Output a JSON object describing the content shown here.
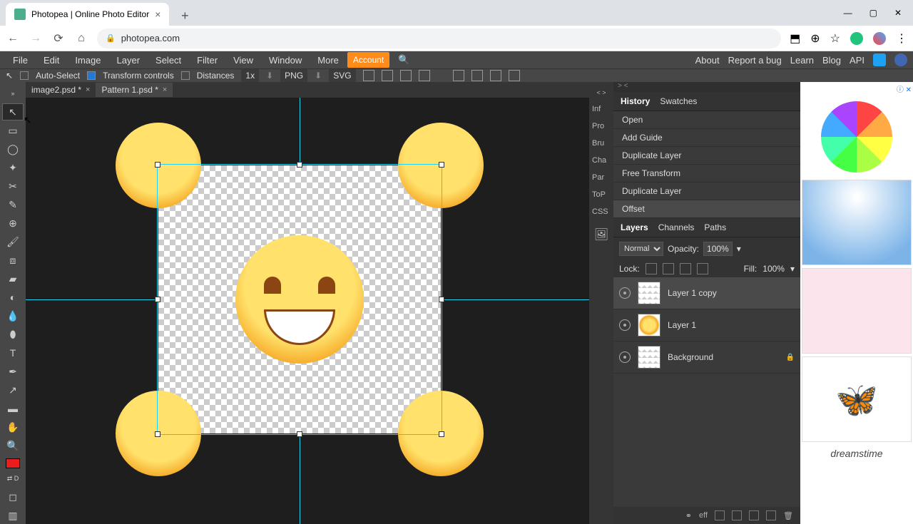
{
  "browser": {
    "tab_title": "Photopea | Online Photo Editor",
    "url": "photopea.com"
  },
  "menu": {
    "items": [
      "File",
      "Edit",
      "Image",
      "Layer",
      "Select",
      "Filter",
      "View",
      "Window",
      "More"
    ],
    "account": "Account",
    "right": [
      "About",
      "Report a bug",
      "Learn",
      "Blog",
      "API"
    ]
  },
  "options": {
    "auto_select": "Auto-Select",
    "transform_controls": "Transform controls",
    "distances": "Distances",
    "zoom": "1x",
    "png": "PNG",
    "svg": "SVG"
  },
  "doc_tabs": [
    {
      "name": "image2.psd *"
    },
    {
      "name": "Pattern 1.psd *"
    }
  ],
  "side_panels": [
    "Inf",
    "Pro",
    "Bru",
    "Cha",
    "Par",
    "ToP",
    "CSS"
  ],
  "history": {
    "tabs": [
      "History",
      "Swatches"
    ],
    "items": [
      "Open",
      "Add Guide",
      "Duplicate Layer",
      "Free Transform",
      "Duplicate Layer",
      "Offset"
    ]
  },
  "layers_panel": {
    "tabs": [
      "Layers",
      "Channels",
      "Paths"
    ],
    "blend": "Normal",
    "opacity_label": "Opacity:",
    "opacity": "100%",
    "lock_label": "Lock:",
    "fill_label": "Fill:",
    "fill": "100%",
    "layers": [
      {
        "name": "Layer 1 copy",
        "selected": true
      },
      {
        "name": "Layer 1",
        "selected": false
      },
      {
        "name": "Background",
        "selected": false,
        "locked": true
      }
    ],
    "footer_eff": "eff"
  },
  "ad_brand": "dreamstime",
  "collapse": {
    "left": "< >",
    "right": "> <"
  }
}
